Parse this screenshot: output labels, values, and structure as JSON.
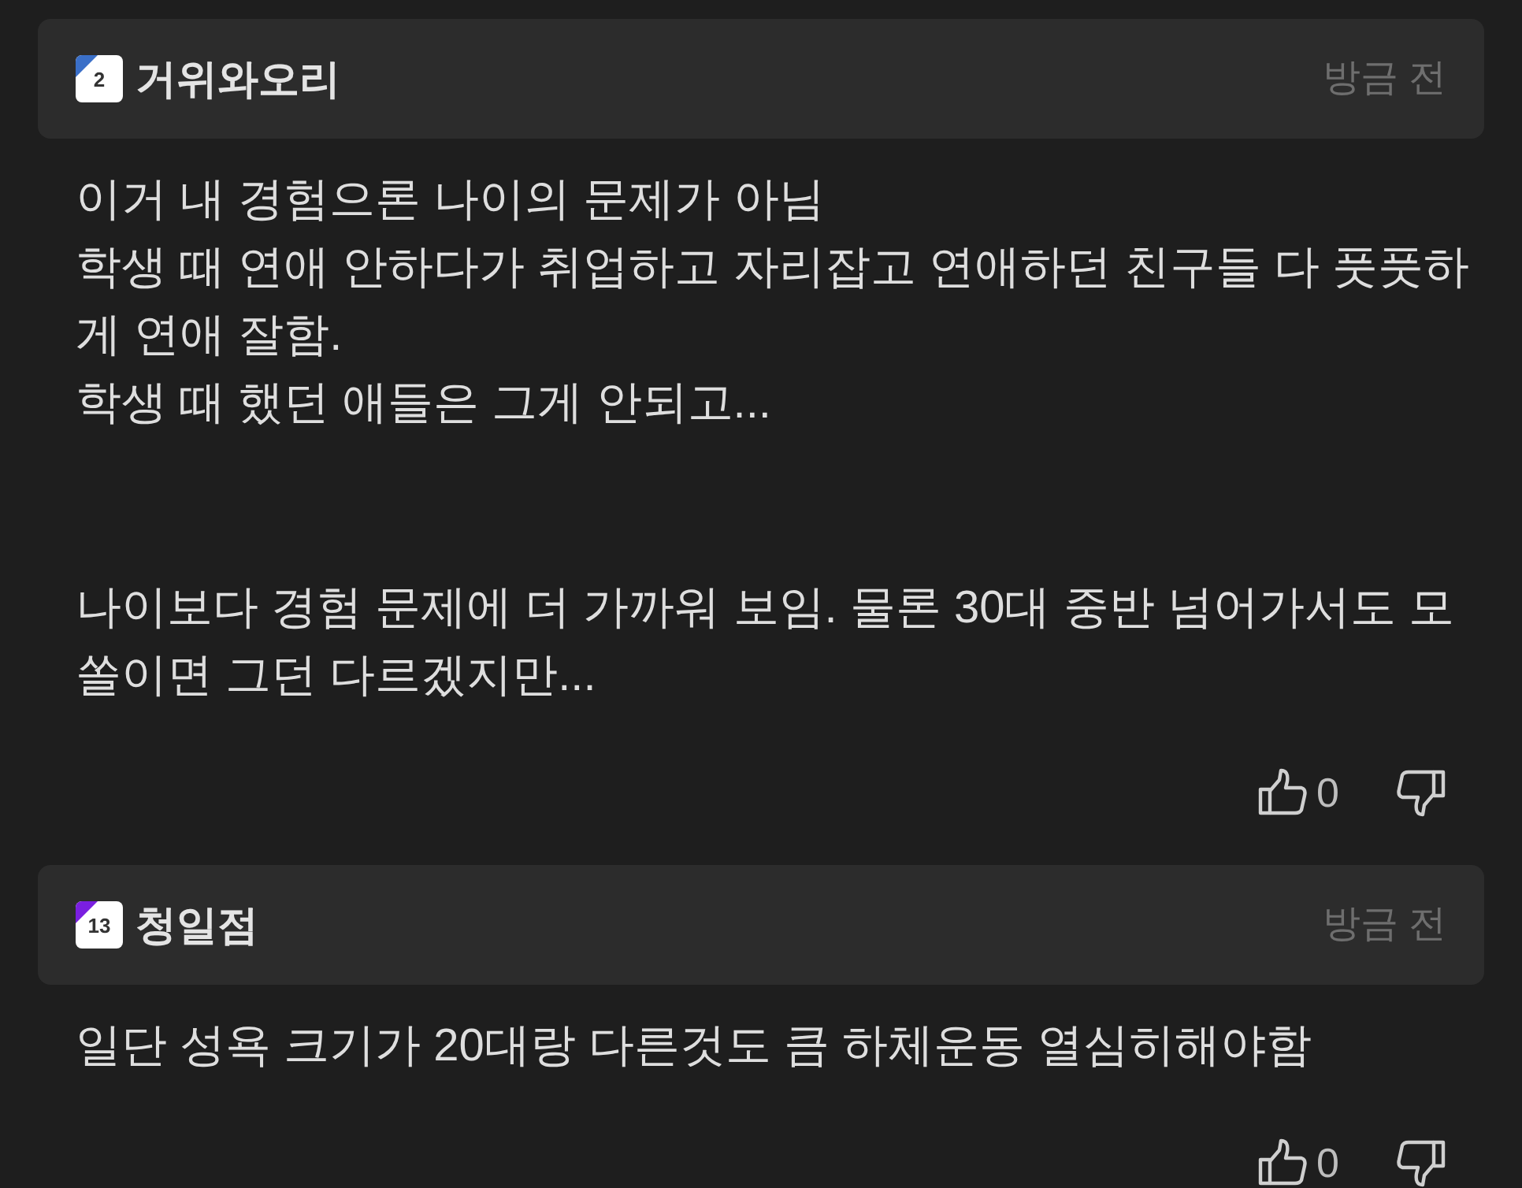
{
  "comments": [
    {
      "level": "2",
      "color": "#3a6fc8",
      "author": "거위와오리",
      "time": "방금 전",
      "paragraphs": [
        [
          "이거 내 경험으론 나이의 문제가 아님",
          "학생 때 연애 안하다가 취업하고 자리잡고 연애하던 친구들 다 풋풋하",
          "게 연애 잘함.",
          "학생 때 했던 애들은 그게 안되고..."
        ],
        [
          "나이보다 경험 문제에 더 가까워 보임. 물론 30대 중반 넘어가서도 모",
          "쏠이면 그던 다르겠지만..."
        ]
      ],
      "likes": "0"
    },
    {
      "level": "13",
      "color": "#7a1fe0",
      "author": "청일점",
      "time": "방금 전",
      "paragraphs": [
        [
          "일단 성욕 크기가 20대랑 다른것도 큼 하체운동 열심히해야함"
        ]
      ],
      "likes": "0"
    }
  ]
}
